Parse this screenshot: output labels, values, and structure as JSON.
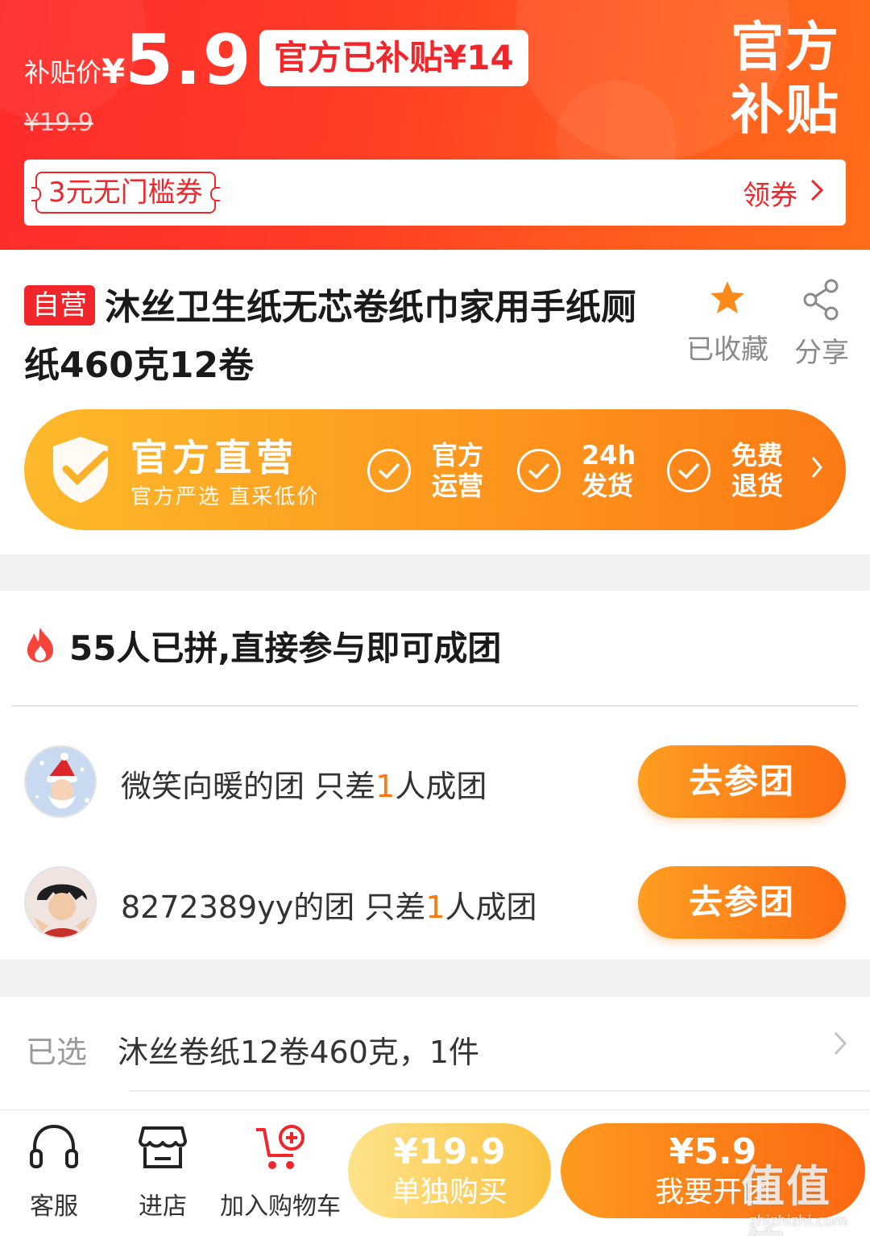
{
  "banner": {
    "price_prefix": "补贴价",
    "currency": "¥",
    "price": "5.9",
    "subsidy_text": "官方已补贴¥14",
    "original_price": "¥19.9",
    "badge_line1": "官方",
    "badge_line2": "补贴",
    "coupon_label": "3元无门槛券",
    "coupon_action": "领券",
    "colors": {
      "primary_red": "#f0262a",
      "banner_orange": "#ff6d1a"
    }
  },
  "product": {
    "self_operated_tag": "自营",
    "title": "沐丝卫生纸无芯卷纸巾家用手纸厕纸460克12卷",
    "favorite_label": "已收藏",
    "share_label": "分享"
  },
  "official_strip": {
    "title": "官方直营",
    "subtitle": "官方严选 直采低价",
    "features": [
      {
        "line1": "官方",
        "line2": "运营"
      },
      {
        "line1": "24h",
        "line2": "发货"
      },
      {
        "line1": "免费",
        "line2": "退货"
      }
    ],
    "colors": {
      "start": "#fdb92b",
      "end": "#fc7a14"
    }
  },
  "group": {
    "header": "55人已拼,直接参与即可成团",
    "rows": [
      {
        "name": "微笑向暖的团",
        "prefix": "只差",
        "count": "1",
        "suffix": "人成团",
        "button": "去参团"
      },
      {
        "name": "8272389yy的团",
        "prefix": "只差",
        "count": "1",
        "suffix": "人成团",
        "button": "去参团"
      }
    ]
  },
  "spec": {
    "label": "已选",
    "value": "沐丝卷纸12卷460克，1件"
  },
  "bottom_bar": {
    "service_label": "客服",
    "store_label": "进店",
    "cart_label": "加入购物车",
    "single_price": "¥19.9",
    "single_label": "单独购买",
    "group_price": "¥5.9",
    "group_label": "我要开团"
  },
  "watermark": {
    "main": "值值值",
    "sub": "zhizhizhi.com"
  }
}
